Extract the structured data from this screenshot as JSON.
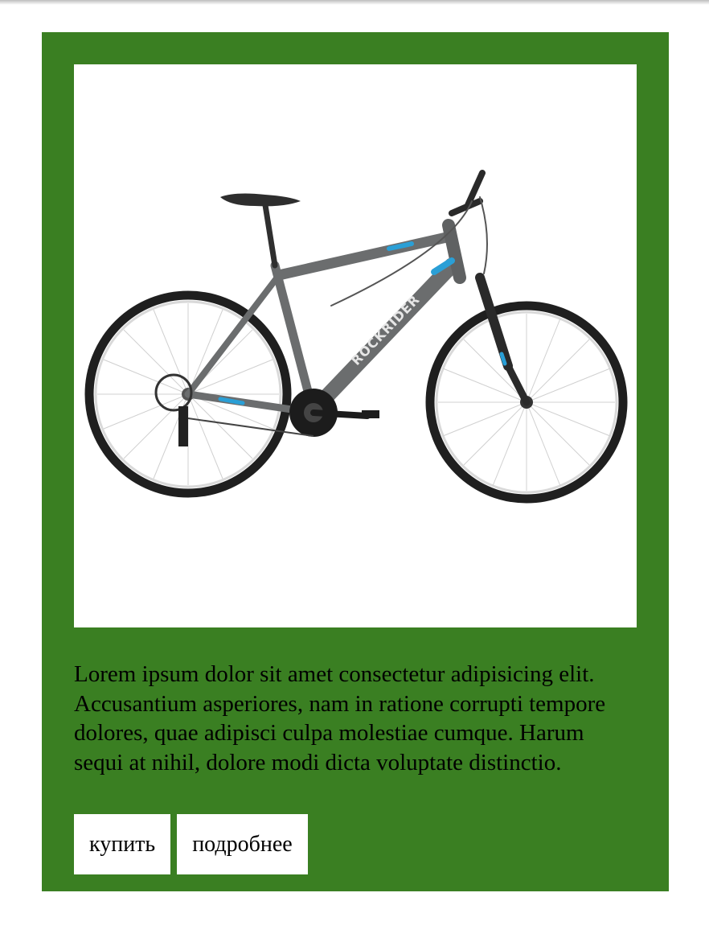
{
  "card": {
    "background_color": "#3a7f22",
    "image": {
      "brand_text": "ROCKRIDER",
      "accent_color": "#2a9fd6",
      "frame_color": "#6b6d6e"
    },
    "description": "Lorem ipsum dolor sit amet consectetur adipisicing elit. Accusantium asperiores, nam in ratione corrupti tempore dolores, quae adipisci culpa molestiae cumque. Harum sequi at nihil, dolore modi dicta voluptate distinctio.",
    "buttons": {
      "buy_label": "купить",
      "details_label": "подробнее"
    }
  }
}
